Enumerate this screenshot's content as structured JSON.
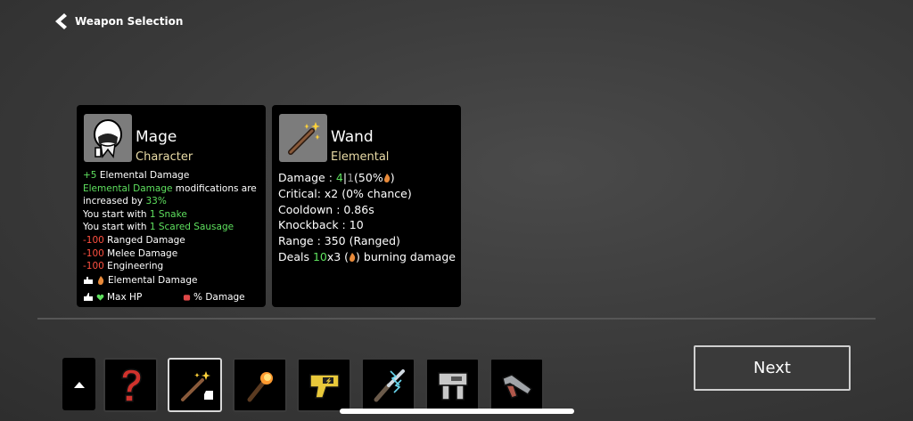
{
  "header": {
    "title": "Weapon Selection"
  },
  "character_card": {
    "name": "Mage",
    "subtitle": "Character",
    "lines": [
      {
        "parts": [
          {
            "text": "+5",
            "color": "green"
          },
          {
            "text": " Elemental Damage",
            "color": "white"
          }
        ]
      },
      {
        "parts": [
          {
            "text": "Elemental Damage",
            "color": "green"
          },
          {
            "text": " modifications are",
            "color": "white"
          }
        ]
      },
      {
        "parts": [
          {
            "text": "increased by ",
            "color": "white"
          },
          {
            "text": "33%",
            "color": "green"
          }
        ]
      },
      {
        "parts": [
          {
            "text": "You start with ",
            "color": "white"
          },
          {
            "text": "1 Snake",
            "color": "green"
          }
        ]
      },
      {
        "parts": [
          {
            "text": "You start with ",
            "color": "white"
          },
          {
            "text": "1 Scared Sausage",
            "color": "green"
          }
        ]
      },
      {
        "parts": [
          {
            "text": "-100",
            "color": "red"
          },
          {
            "text": " Ranged Damage",
            "color": "white"
          }
        ]
      },
      {
        "parts": [
          {
            "text": "-100",
            "color": "red"
          },
          {
            "text": " Melee Damage",
            "color": "white"
          }
        ]
      },
      {
        "parts": [
          {
            "text": "-100",
            "color": "red"
          },
          {
            "text": " Engineering",
            "color": "white"
          }
        ]
      }
    ],
    "footer_elemental": "Elemental Damage",
    "footer_maxhp": "Max HP",
    "footer_damage": "% Damage"
  },
  "weapon_card": {
    "name": "Wand",
    "subtitle": "Elemental",
    "lines": [
      {
        "parts": [
          {
            "text": "Damage : ",
            "color": "white"
          },
          {
            "text": "4",
            "color": "green"
          },
          {
            "text": "|",
            "color": "white"
          },
          {
            "text": "1",
            "color": "gray"
          },
          {
            "text": "(50%",
            "color": "white"
          },
          {
            "icon": "fire"
          },
          {
            "text": ")",
            "color": "white"
          }
        ]
      },
      {
        "parts": [
          {
            "text": "Critical: x2 (0% chance)",
            "color": "white"
          }
        ]
      },
      {
        "parts": [
          {
            "text": "Cooldown : 0.86s",
            "color": "white"
          }
        ]
      },
      {
        "parts": [
          {
            "text": "Knockback : 10",
            "color": "white"
          }
        ]
      },
      {
        "parts": [
          {
            "text": "Range : 350 (Ranged)",
            "color": "white"
          }
        ]
      },
      {
        "parts": [
          {
            "text": "Deals ",
            "color": "white"
          },
          {
            "text": "10",
            "color": "green"
          },
          {
            "text": "x3 (",
            "color": "white"
          },
          {
            "icon": "fire"
          },
          {
            "text": ") burning damage",
            "color": "white"
          }
        ]
      }
    ]
  },
  "weapon_slots": [
    {
      "icon": "random-question-mark-icon",
      "selected": false
    },
    {
      "icon": "wand-icon",
      "selected": true
    },
    {
      "icon": "torch-icon",
      "selected": false
    },
    {
      "icon": "taser-icon",
      "selected": false
    },
    {
      "icon": "lightning-shiv-icon",
      "selected": false
    },
    {
      "icon": "robot-gun-icon",
      "selected": false
    },
    {
      "icon": "shotgun-icon",
      "selected": false
    }
  ],
  "next_button": {
    "label": "Next"
  },
  "colors": {
    "green": "#5ee05e",
    "red": "#ff5040",
    "gray": "#9a9a9a",
    "subtitle": "#e9dba6",
    "card_bg": "#000000",
    "screen_bg": "#3c3c3c"
  }
}
